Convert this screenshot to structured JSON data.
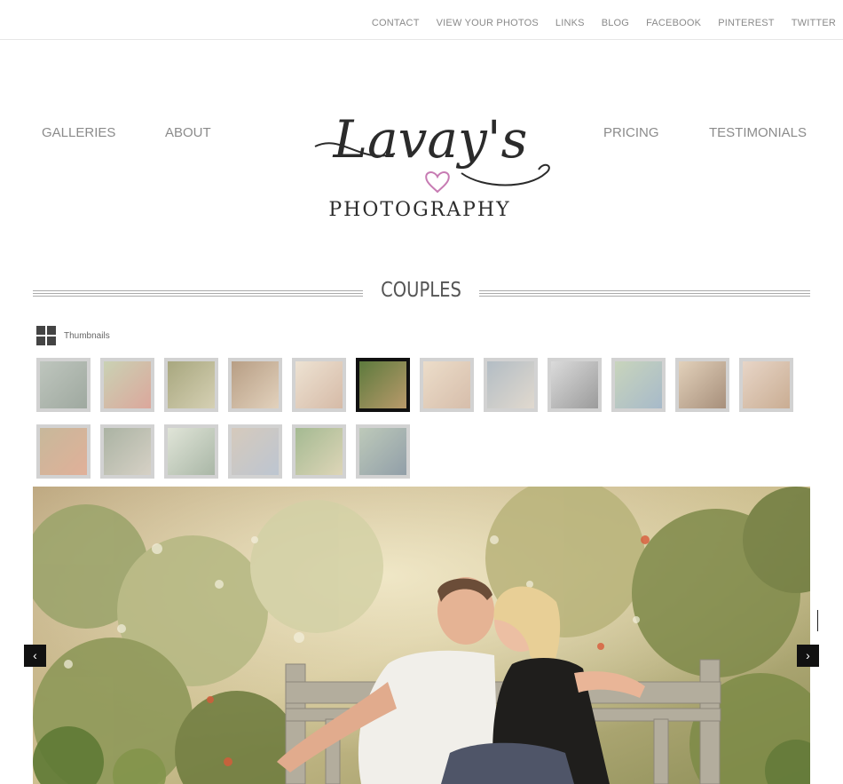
{
  "topnav": [
    "CONTACT",
    "VIEW YOUR PHOTOS",
    "LINKS",
    "BLOG",
    "FACEBOOK",
    "PINTEREST",
    "TWITTER"
  ],
  "mainnav": {
    "galleries": "GALLERIES",
    "about": "ABOUT",
    "pricing": "PRICING",
    "testimonials": "TESTIMONIALS"
  },
  "logo": {
    "script": "Lavay's",
    "sub": "PHOTOGRAPHY",
    "heart_color": "#c77bb3",
    "ink_color": "#2b2b2b"
  },
  "section": {
    "title": "COUPLES"
  },
  "thumbnails": {
    "label": "Thumbnails",
    "active_index": 5,
    "items": [
      "thumb-1",
      "thumb-2",
      "thumb-3",
      "thumb-4",
      "thumb-5",
      "thumb-6",
      "thumb-7",
      "thumb-8",
      "thumb-9",
      "thumb-10",
      "thumb-11",
      "thumb-12",
      "thumb-13",
      "thumb-14",
      "thumb-15",
      "thumb-16",
      "thumb-17",
      "thumb-18"
    ]
  },
  "slideshow": {
    "prev_icon": "chevron-left-icon",
    "next_icon": "chevron-right-icon",
    "prev_glyph": "‹",
    "next_glyph": "›"
  }
}
